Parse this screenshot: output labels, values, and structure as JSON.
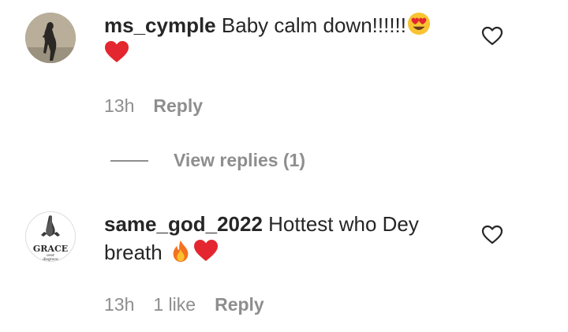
{
  "comments": [
    {
      "username": "ms_cymple",
      "text": "Baby calm down!!!!!!",
      "emojis": [
        "heart-eyes-emoji",
        "red-heart-emoji"
      ],
      "time": "13h",
      "likes": "",
      "reply_label": "Reply",
      "view_replies": "View replies (1)"
    },
    {
      "username": "same_god_2022",
      "text": "Hottest who Dey breath",
      "emojis": [
        "fire-emoji",
        "red-heart-emoji"
      ],
      "time": "13h",
      "likes": "1 like",
      "reply_label": "Reply",
      "avatar_text": "GRACE",
      "avatar_subtext": "over",
      "avatar_subtext2": "disgrace"
    }
  ],
  "colors": {
    "text": "#262626",
    "secondary": "#8e8e8e",
    "heart_red": "#e3262f"
  }
}
